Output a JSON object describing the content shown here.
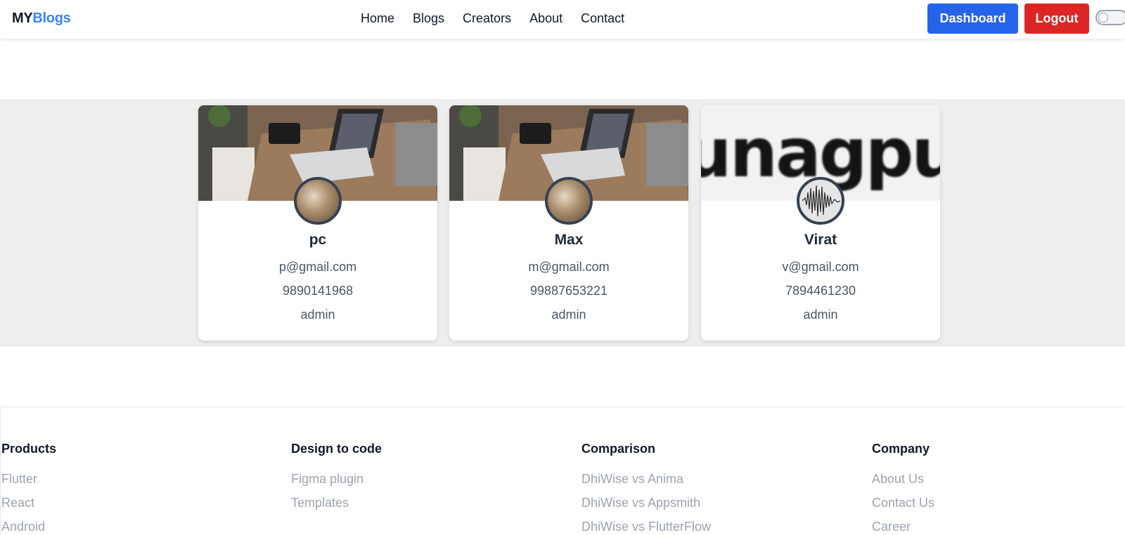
{
  "header": {
    "logo_part1": "MY",
    "logo_part2": "Blogs",
    "nav": [
      "Home",
      "Blogs",
      "Creators",
      "About",
      "Contact"
    ],
    "dashboard_label": "Dashboard",
    "logout_label": "Logout",
    "theme_toggle": "off"
  },
  "creators": [
    {
      "name": "pc",
      "email": "p@gmail.com",
      "phone": "9890141968",
      "role": "admin",
      "cover": "desk-photo",
      "avatar": "desk-photo"
    },
    {
      "name": "Max",
      "email": "m@gmail.com",
      "phone": "99887653221",
      "role": "admin",
      "cover": "desk-photo",
      "avatar": "desk-photo"
    },
    {
      "name": "Virat",
      "email": "v@gmail.com",
      "phone": "7894461230",
      "role": "admin",
      "cover_text": "unagpu",
      "avatar": "waveform"
    }
  ],
  "footer": {
    "columns": [
      {
        "title": "Products",
        "links": [
          "Flutter",
          "React",
          "Android"
        ]
      },
      {
        "title": "Design to code",
        "links": [
          "Figma plugin",
          "Templates"
        ]
      },
      {
        "title": "Comparison",
        "links": [
          "DhiWise vs Anima",
          "DhiWise vs Appsmith",
          "DhiWise vs FlutterFlow"
        ]
      },
      {
        "title": "Company",
        "links": [
          "About Us",
          "Contact Us",
          "Career"
        ]
      }
    ]
  },
  "colors": {
    "brand_blue": "#3b82f6",
    "dashboard_button": "#2563eb",
    "logout_button": "#dc2626",
    "band_background": "#eeeeee",
    "footer_link": "#9ca3af"
  }
}
